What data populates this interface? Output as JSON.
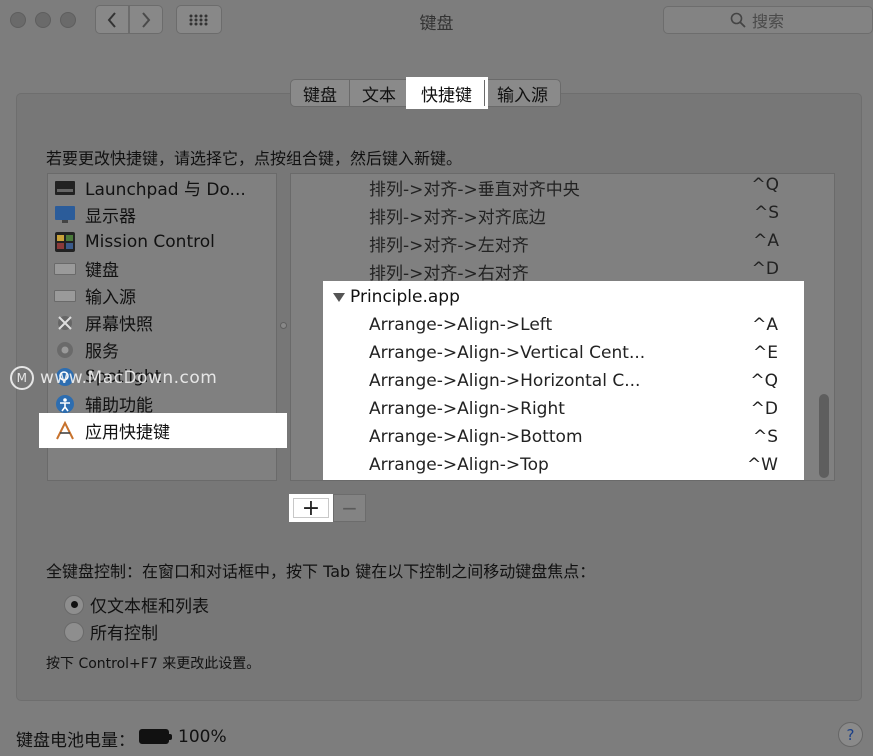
{
  "window": {
    "title": "键盘"
  },
  "search": {
    "placeholder": "搜索"
  },
  "tabs": [
    {
      "label": "键盘",
      "active": false
    },
    {
      "label": "文本",
      "active": false
    },
    {
      "label": "快捷键",
      "active": true
    },
    {
      "label": "输入源",
      "active": false
    }
  ],
  "instruction": "若要更改快捷键，请选择它，点按组合键，然后键入新键。",
  "categories": [
    {
      "label": "Launchpad 与 Do...",
      "icon": "launchpad-icon"
    },
    {
      "label": "显示器",
      "icon": "display-icon"
    },
    {
      "label": "Mission Control",
      "icon": "mission-control-icon"
    },
    {
      "label": "键盘",
      "icon": "keyboard-icon"
    },
    {
      "label": "输入源",
      "icon": "input-source-icon"
    },
    {
      "label": "屏幕快照",
      "icon": "screenshot-icon"
    },
    {
      "label": "服务",
      "icon": "gear-icon"
    },
    {
      "label": "Spotlight",
      "icon": "spotlight-icon"
    },
    {
      "label": "辅助功能",
      "icon": "accessibility-icon"
    },
    {
      "label": "应用快捷键",
      "icon": "app-shortcuts-icon",
      "selected": true
    }
  ],
  "shortcuts_above": [
    {
      "name": "排列->对齐->垂直对齐中央",
      "key": "^Q"
    },
    {
      "name": "排列->对齐->对齐底边",
      "key": "^S"
    },
    {
      "name": "排列->对齐->左对齐",
      "key": "^A"
    },
    {
      "name": "排列->对齐->右对齐",
      "key": "^D"
    }
  ],
  "app_group": {
    "name": "Principle.app",
    "items": [
      {
        "name": "Arrange->Align->Left",
        "key": "^A"
      },
      {
        "name": "Arrange->Align->Vertical Cent...",
        "key": "^E"
      },
      {
        "name": "Arrange->Align->Horizontal C...",
        "key": "^Q"
      },
      {
        "name": "Arrange->Align->Right",
        "key": "^D"
      },
      {
        "name": "Arrange->Align->Bottom",
        "key": "^S"
      },
      {
        "name": "Arrange->Align->Top",
        "key": "^W"
      }
    ]
  },
  "buttons": {
    "add": "+",
    "remove": "−"
  },
  "keyboard_control": {
    "title": "全键盘控制：在窗口和对话框中，按下 Tab 键在以下控制之间移动键盘焦点：",
    "options": [
      {
        "label": "仅文本框和列表",
        "checked": true
      },
      {
        "label": "所有控制",
        "checked": false
      }
    ],
    "hint": "按下 Control+F7 来更改此设置。"
  },
  "footer": {
    "battery_label": "键盘电池电量：",
    "battery_value": "100%",
    "help": "?"
  },
  "watermark": {
    "text": "www.MacDown.com",
    "logo": "M"
  }
}
